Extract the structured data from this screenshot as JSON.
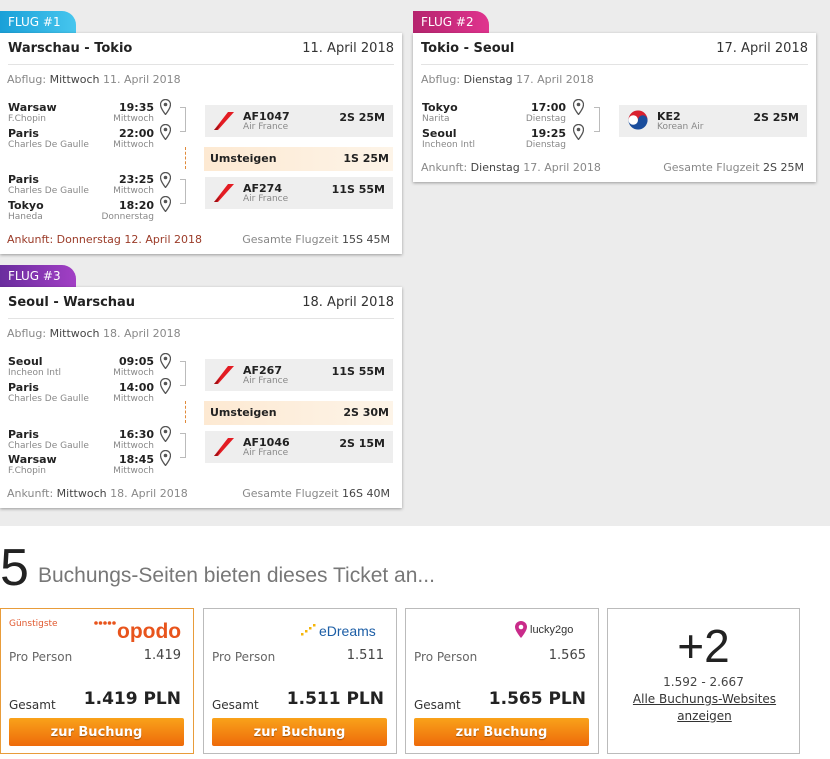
{
  "flights": [
    {
      "tab": "FLUG #1",
      "route": "Warschau - Tokio",
      "date": "11. April 2018",
      "departure_label": "Abflug:",
      "departure_value": "Mittwoch",
      "departure_date": "11. April 2018",
      "stops": [
        {
          "city": "Warsaw",
          "airport": "F.Chopin",
          "time": "19:35",
          "day": "Mittwoch"
        },
        {
          "city": "Paris",
          "airport": "Charles De Gaulle",
          "time": "22:00",
          "day": "Mittwoch"
        },
        {
          "city": "Paris",
          "airport": "Charles De Gaulle",
          "time": "23:25",
          "day": "Mittwoch"
        },
        {
          "city": "Tokyo",
          "airport": "Haneda",
          "time": "18:20",
          "day": "Donnerstag"
        }
      ],
      "segments": [
        {
          "code": "AF1047",
          "airline": "Air France",
          "duration": "2S 25M"
        },
        {
          "code": "AF274",
          "airline": "Air France",
          "duration": "11S 55M"
        }
      ],
      "layover": {
        "label": "Umsteigen",
        "duration": "1S 25M"
      },
      "arrival_label": "Ankunft:",
      "arrival_value": "Donnerstag 12. April 2018",
      "total_label": "Gesamte Flugzeit",
      "total_value": "15S 45M"
    },
    {
      "tab": "FLUG #2",
      "route": "Tokio - Seoul",
      "date": "17. April 2018",
      "departure_label": "Abflug:",
      "departure_value": "Dienstag",
      "departure_date": "17. April 2018",
      "stops": [
        {
          "city": "Tokyo",
          "airport": "Narita",
          "time": "17:00",
          "day": "Dienstag"
        },
        {
          "city": "Seoul",
          "airport": "Incheon Intl",
          "time": "19:25",
          "day": "Dienstag"
        }
      ],
      "segments": [
        {
          "code": "KE2",
          "airline": "Korean Air",
          "duration": "2S 25M"
        }
      ],
      "arrival_label": "Ankunft:",
      "arrival_value": "Dienstag",
      "arrival_date": "17. April 2018",
      "total_label": "Gesamte Flugzeit",
      "total_value": "2S 25M"
    },
    {
      "tab": "FLUG #3",
      "route": "Seoul - Warschau",
      "date": "18. April 2018",
      "departure_label": "Abflug:",
      "departure_value": "Mittwoch",
      "departure_date": "18. April 2018",
      "stops": [
        {
          "city": "Seoul",
          "airport": "Incheon Intl",
          "time": "09:05",
          "day": "Mittwoch"
        },
        {
          "city": "Paris",
          "airport": "Charles De Gaulle",
          "time": "14:00",
          "day": "Mittwoch"
        },
        {
          "city": "Paris",
          "airport": "Charles De Gaulle",
          "time": "16:30",
          "day": "Mittwoch"
        },
        {
          "city": "Warsaw",
          "airport": "F.Chopin",
          "time": "18:45",
          "day": "Mittwoch"
        }
      ],
      "segments": [
        {
          "code": "AF267",
          "airline": "Air France",
          "duration": "11S 55M"
        },
        {
          "code": "AF1046",
          "airline": "Air France",
          "duration": "2S 15M"
        }
      ],
      "layover": {
        "label": "Umsteigen",
        "duration": "2S 30M"
      },
      "arrival_label": "Ankunft:",
      "arrival_value": "Mittwoch",
      "arrival_date": "18. April 2018",
      "total_label": "Gesamte Flugzeit",
      "total_value": "16S 40M"
    }
  ],
  "booking": {
    "count": "5",
    "headline": "Buchungs-Seiten bieten dieses Ticket an...",
    "offers": [
      {
        "badge": "Günstigste",
        "site": "opodo",
        "per_label": "Pro Person",
        "per_value": "1.419",
        "total_label": "Gesamt",
        "total_value": "1.419 PLN",
        "button": "zur Buchung"
      },
      {
        "site": "eDreams",
        "per_label": "Pro Person",
        "per_value": "1.511",
        "total_label": "Gesamt",
        "total_value": "1.511 PLN",
        "button": "zur Buchung"
      },
      {
        "site": "lucky2go",
        "per_label": "Pro Person",
        "per_value": "1.565",
        "total_label": "Gesamt",
        "total_value": "1.565 PLN",
        "button": "zur Buchung"
      }
    ],
    "more": {
      "count": "+2",
      "range": "1.592 - 2.667",
      "link": "Alle Buchungs-Websites anzeigen"
    }
  },
  "colors": {
    "tab1": "#1aa0d8",
    "tab2": "#c42a7c",
    "tab3": "#7b32ab",
    "button": "#f28a12",
    "cheapest": "#e0582e"
  }
}
